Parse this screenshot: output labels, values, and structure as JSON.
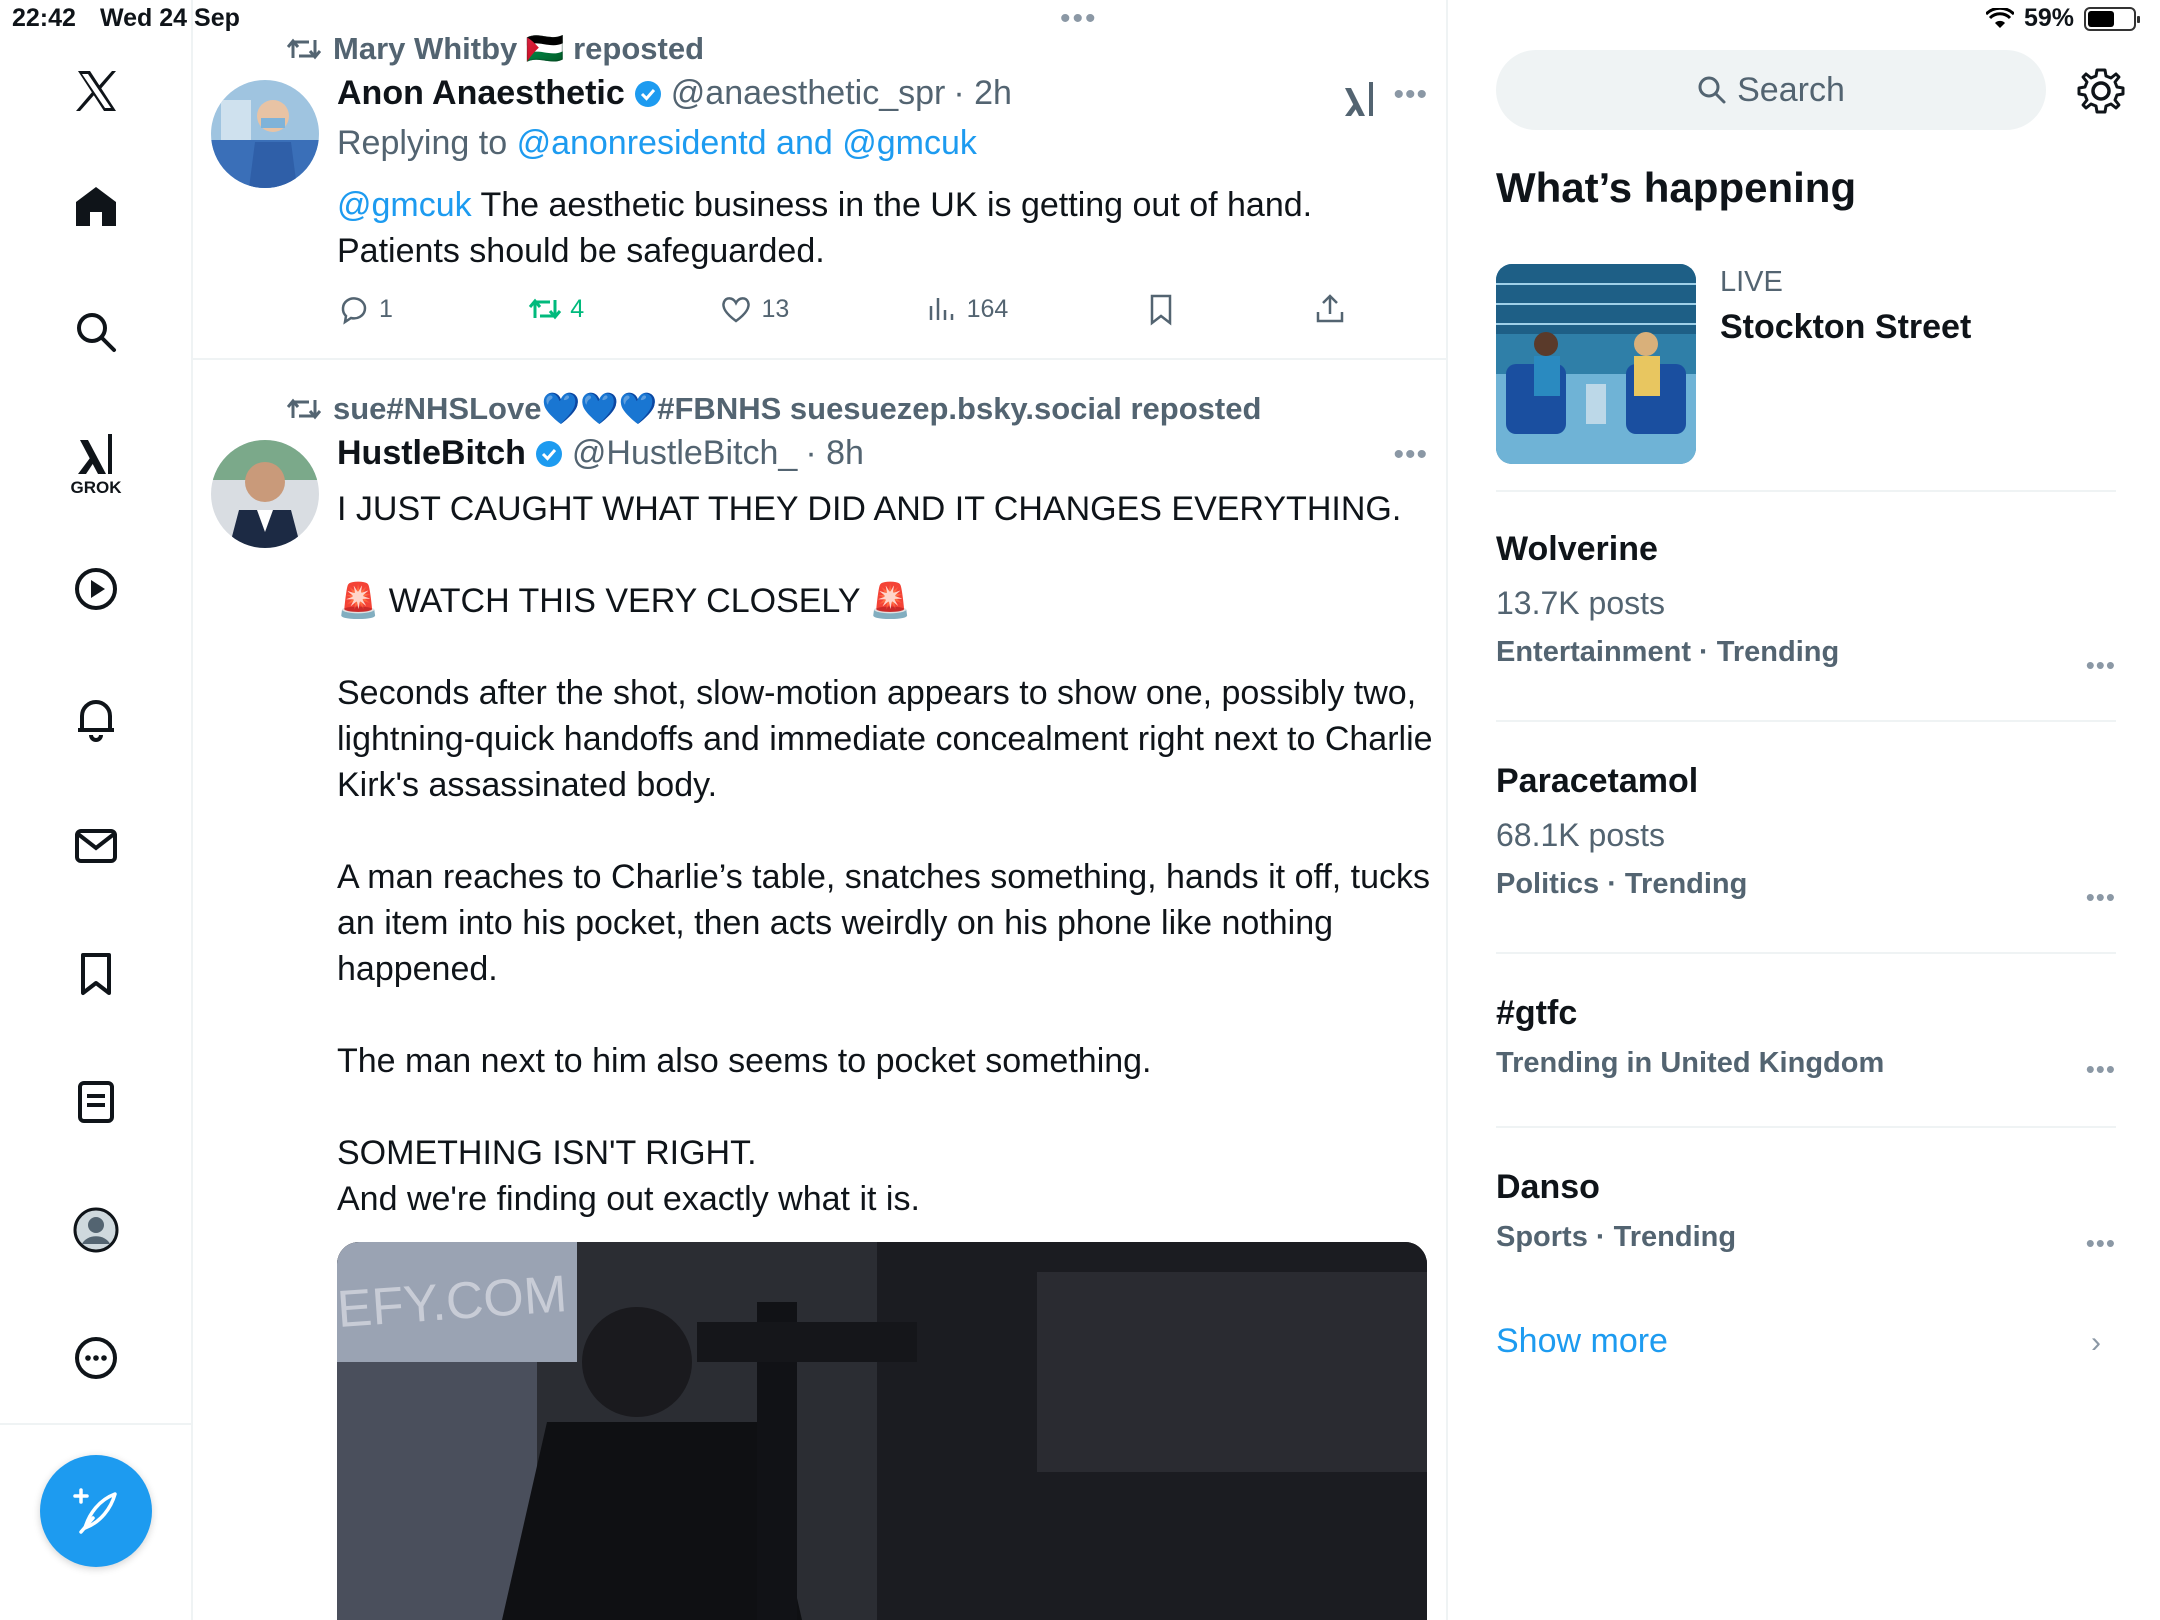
{
  "status_bar": {
    "time": "22:42",
    "date": "Wed 24 Sep",
    "battery": "59%",
    "battery_level": 0.59
  },
  "sidebar": {
    "items": [
      {
        "name": "x-logo",
        "label": ""
      },
      {
        "name": "home",
        "label": ""
      },
      {
        "name": "search",
        "label": ""
      },
      {
        "name": "grok",
        "label": "GROK"
      },
      {
        "name": "video",
        "label": ""
      },
      {
        "name": "notifications",
        "label": ""
      },
      {
        "name": "messages",
        "label": ""
      },
      {
        "name": "bookmarks",
        "label": ""
      },
      {
        "name": "lists",
        "label": ""
      },
      {
        "name": "profile",
        "label": ""
      },
      {
        "name": "more",
        "label": ""
      }
    ]
  },
  "feed": {
    "posts": [
      {
        "repost_by": "Mary Whitby 🇵🇸 reposted",
        "author_name": "Anon Anaesthetic",
        "handle": "@anaesthetic_spr",
        "time": "· 2h",
        "replying_prefix": "Replying to",
        "replying_to": "@anonresidentd and @gmcuk",
        "mention": "@gmcuk",
        "text_line1": " The aesthetic business in the UK is getting out of hand.",
        "text_line2": "Patients should be safeguarded.",
        "replies": "1",
        "reposts": "4",
        "likes": "13",
        "views": "164",
        "accent_repost_color": "#00ba7c"
      },
      {
        "repost_by": "sue#NHSLove💙💙💙#FBNHS suesuezep.bsky.social reposted",
        "author_name": "HustleBitch",
        "handle": "@HustleBitch_",
        "time": "· 8h",
        "paragraphs": [
          "I JUST CAUGHT WHAT THEY DID AND IT CHANGES EVERYTHING.",
          "🚨 WATCH THIS VERY CLOSELY 🚨",
          "Seconds after the shot, slow-motion appears to show one, possibly two, lightning-quick handoffs and immediate concealment right next to Charlie Kirk's assassinated body.",
          "A man reaches to Charlie’s table, snatches something, hands it off, tucks an item into his pocket, then acts weirdly on his phone like nothing happened.",
          "The man next to him also seems to pocket something.",
          "SOMETHING ISN'T RIGHT.",
          "And we're finding out exactly what it is."
        ],
        "media_text": "EFY.COM"
      }
    ]
  },
  "right": {
    "search_placeholder": "Search",
    "section_title": "What’s happening",
    "live": {
      "label": "LIVE",
      "title": "Stockton Street"
    },
    "trends": [
      {
        "name": "Wolverine",
        "posts": "13.7K posts",
        "category": "Entertainment · Trending"
      },
      {
        "name": "Paracetamol",
        "posts": "68.1K posts",
        "category": "Politics · Trending"
      },
      {
        "name": "#gtfc",
        "posts": "",
        "category": "Trending in United Kingdom"
      },
      {
        "name": "Danso",
        "posts": "",
        "category": "Sports · Trending"
      }
    ],
    "show_more": "Show more"
  },
  "colors": {
    "accent": "#1d9bf0",
    "text": "#0f1419",
    "muted": "#536471",
    "repost_green": "#00ba7c",
    "verified": "#1d9bf0"
  }
}
